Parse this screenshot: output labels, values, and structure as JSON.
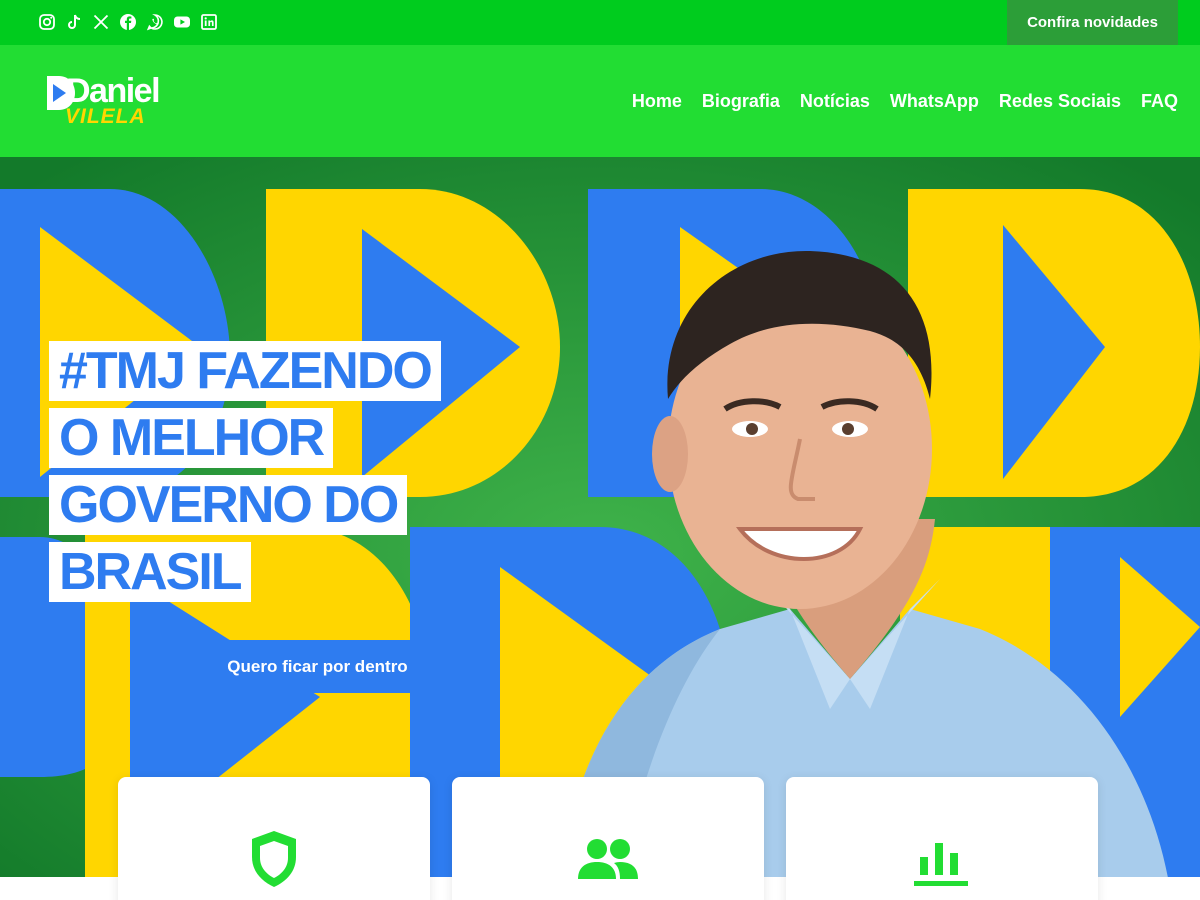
{
  "topbar": {
    "social_icons": [
      "instagram-icon",
      "tiktok-icon",
      "x-icon",
      "facebook-icon",
      "whatsapp-icon",
      "youtube-icon",
      "linkedin-icon"
    ],
    "cta_label": "Confira novidades"
  },
  "header": {
    "logo": {
      "first": "Daniel",
      "last": "VILELA"
    },
    "nav": [
      "Home",
      "Biografia",
      "Notícias",
      "WhatsApp",
      "Redes Sociais",
      "FAQ"
    ]
  },
  "hero": {
    "headline": [
      "#TMJ FAZENDO",
      "O MELHOR",
      "GOVERNO DO",
      "BRASIL"
    ],
    "cta_label": "Quero ficar por dentro"
  },
  "cards": [
    {
      "icon": "shield-icon"
    },
    {
      "icon": "users-icon"
    },
    {
      "icon": "bar-chart-icon"
    }
  ],
  "colors": {
    "topbar": "#00cc1e",
    "header": "#22dd33",
    "cta_dark": "#2c9e38",
    "brand_blue": "#2e7cf0",
    "brand_yellow": "#ffd600",
    "accent_green": "#22dd33"
  }
}
